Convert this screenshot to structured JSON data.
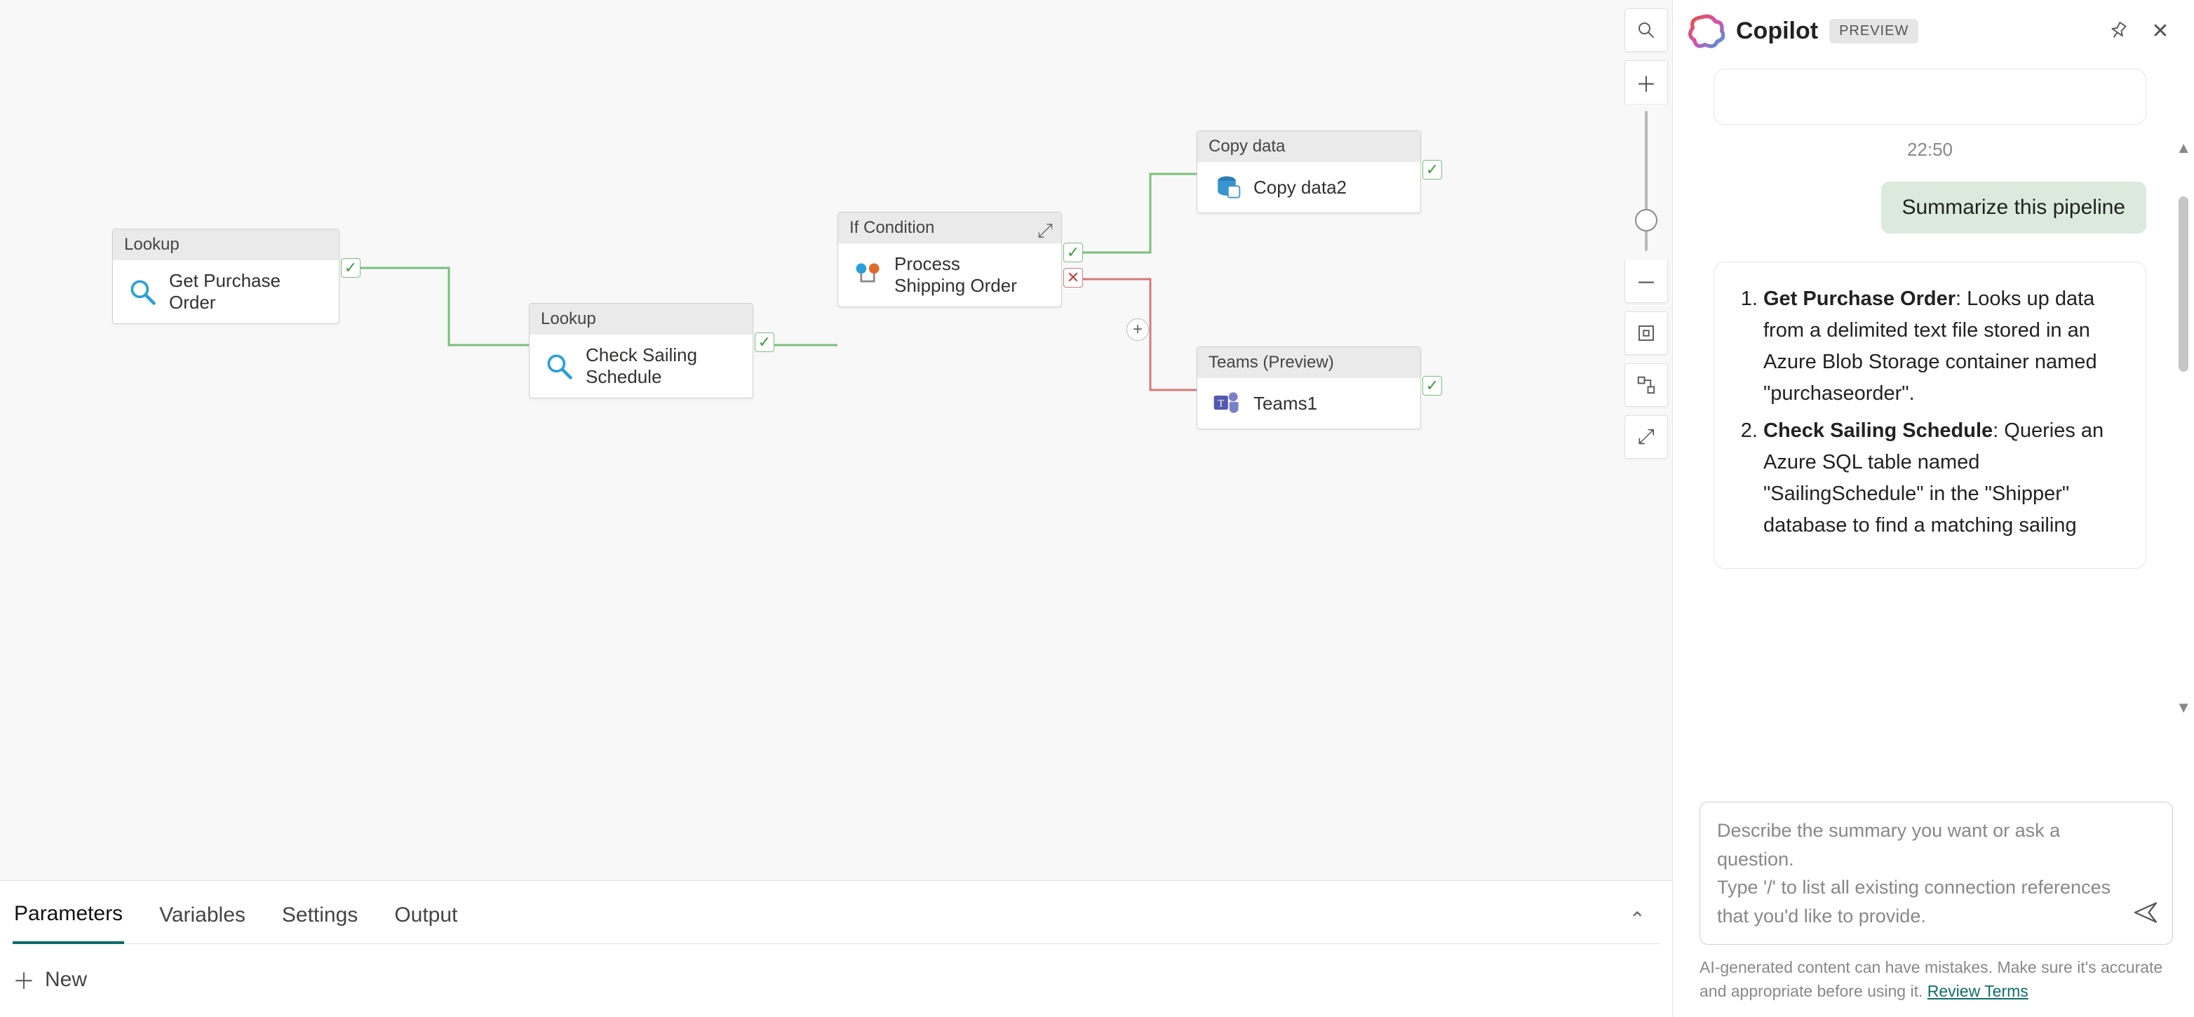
{
  "canvas": {
    "nodes": {
      "lookup1": {
        "type_label": "Lookup",
        "title": "Get Purchase Order"
      },
      "lookup2": {
        "type_label": "Lookup",
        "title": "Check Sailing Schedule"
      },
      "ifcond": {
        "type_label": "If Condition",
        "title": "Process Shipping Order"
      },
      "copy": {
        "type_label": "Copy data",
        "title": "Copy data2"
      },
      "teams": {
        "type_label": "Teams (Preview)",
        "title": "Teams1"
      }
    }
  },
  "bottom_panel": {
    "tabs": {
      "parameters": "Parameters",
      "variables": "Variables",
      "settings": "Settings",
      "output": "Output"
    },
    "new_label": "New"
  },
  "copilot": {
    "title": "Copilot",
    "badge": "PREVIEW",
    "timestamp": "22:50",
    "user_message": "Summarize this pipeline",
    "ai_list": {
      "item1_bold": "Get Purchase Order",
      "item1_text": ": Looks up data from a delimited text file stored in an Azure Blob Storage container named \"purchaseorder\".",
      "item2_bold": "Check Sailing Schedule",
      "item2_text": ": Queries an Azure SQL table named \"SailingSchedule\" in the \"Shipper\" database to find a matching sailing"
    },
    "input_placeholder": "Describe the summary you want or ask a question.\nType '/' to list all existing connection references that you'd like to provide.",
    "disclaimer_prefix": "AI-generated content can have mistakes. Make sure it's accurate and appropriate before using it. ",
    "disclaimer_link": "Review Terms"
  }
}
